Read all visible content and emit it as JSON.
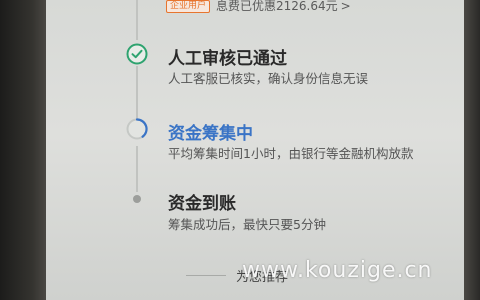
{
  "header": {
    "badge": "企业用户",
    "interest_text": "息费已优惠2126.64元",
    "chevron": ">"
  },
  "steps": [
    {
      "title": "人工审核已通过",
      "description": "人工客服已核实，确认身份信息无误",
      "status": "done",
      "icon": "check-circle-icon"
    },
    {
      "title": "资金筹集中",
      "description": "平均筹集时间1小时，由银行等金融机构放款",
      "status": "in-progress",
      "icon": "progress-circle-icon"
    },
    {
      "title": "资金到账",
      "description": "筹集成功后，最快只要5分钟",
      "status": "pending",
      "icon": "pending-dot-icon"
    }
  ],
  "recommend": {
    "label": "为您推荐"
  },
  "watermark": "www.kouzige.cn",
  "colors": {
    "done": "#2ea36f",
    "in_progress": "#3a74c6",
    "badge": "#e7752f"
  }
}
